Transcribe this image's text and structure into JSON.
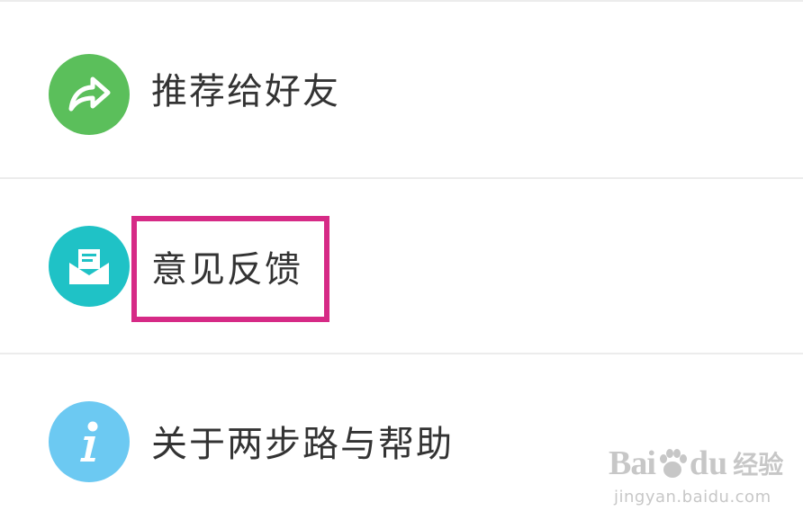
{
  "menu": {
    "items": [
      {
        "label": "推荐给好友",
        "icon": "share-icon",
        "icon_color": "#5bbf5b"
      },
      {
        "label": "意见反馈",
        "icon": "feedback-mail-icon",
        "icon_color": "#1fc2c6"
      },
      {
        "label": "关于两步路与帮助",
        "icon": "info-icon",
        "icon_color": "#6cc9f2"
      }
    ]
  },
  "highlight_color": "#d62a86",
  "watermark": {
    "brand_bai": "Bai",
    "brand_du": "du",
    "brand_jingyan": "经验",
    "url": "jingyan.baidu.com"
  }
}
